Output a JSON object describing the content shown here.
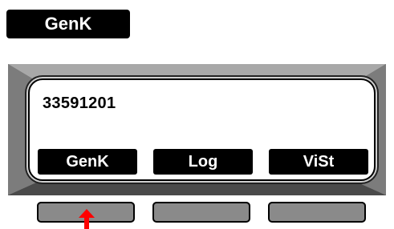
{
  "title_badge": {
    "label": "GenK"
  },
  "screen": {
    "value": "33591201",
    "softkeys": [
      {
        "label": "GenK"
      },
      {
        "label": "Log"
      },
      {
        "label": "ViSt"
      }
    ]
  },
  "colors": {
    "frame_dark": "#3a3a3a",
    "frame_light": "#9a9a9a",
    "button_fill": "#8a8a8a",
    "arrow": "#ff0000"
  },
  "icons": {
    "pointer": "up-arrow-icon"
  }
}
